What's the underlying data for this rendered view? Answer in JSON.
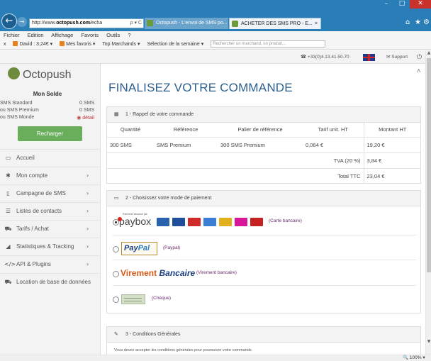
{
  "browser": {
    "address_prefix": "http://www.",
    "address_domain": "octopush.com",
    "address_suffix": "/echa",
    "address_controls": "ρ ▾ C",
    "tabs": [
      {
        "label": "Octopush - L'envoi de SMS po..."
      },
      {
        "label": "ACHETER DES SMS PRO - E...",
        "close": "×"
      }
    ],
    "window_controls": {
      "minimize": "–",
      "maximize": "□",
      "close": "✕"
    },
    "menu": [
      "Fichier",
      "Edition",
      "Affichage",
      "Favoris",
      "Outils",
      "?"
    ],
    "favorites": {
      "close": "x",
      "account": "David : 3,24€ ▾",
      "items": [
        "Mes favoris ▾",
        "Top Marchands ▾",
        "Sélection de la semaine ▾"
      ],
      "search_placeholder": "Rechercher un marchand, un produit..."
    },
    "zoom": "🔍 100%  ▾"
  },
  "topbar": {
    "phone": "☎ +33(0)4.13.41.50.70",
    "support": "✉ Support",
    "power": "⏻ ∧"
  },
  "sidebar": {
    "logo_text": "Octopush",
    "solde_title": "Mon Solde",
    "balances": [
      {
        "label": "SMS Standard",
        "value": "0 SMS"
      },
      {
        "label": "ou SMS Premium",
        "value": "0 SMS"
      },
      {
        "label": "ou SMS Monde",
        "value": "◉ détail"
      }
    ],
    "recharge_label": "Recharger",
    "nav": [
      {
        "icon": "▭",
        "label": "Accueil",
        "chevron": ""
      },
      {
        "icon": "✱",
        "label": "Mon compte",
        "chevron": "›"
      },
      {
        "icon": "▯",
        "label": "Campagne de SMS",
        "chevron": "›"
      },
      {
        "icon": "☰",
        "label": "Listes de contacts",
        "chevron": "›"
      },
      {
        "icon": "⛟",
        "label": "Tarifs / Achat",
        "chevron": "›"
      },
      {
        "icon": "◢",
        "label": "Statistiques & Tracking",
        "chevron": "›"
      },
      {
        "icon": "</>",
        "label": "API & Plugins",
        "chevron": "›"
      },
      {
        "icon": "⛟",
        "label": "Location de base de données",
        "chevron": ""
      }
    ]
  },
  "main": {
    "title": "FINALISEZ VOTRE COMMANDE",
    "section1": {
      "icon": "▦",
      "title": "1 - Rappel de votre commande",
      "headers": [
        "Quantité",
        "Référence",
        "Palier de référence",
        "Tarif unit. HT",
        "Montant HT"
      ],
      "row": [
        "300 SMS",
        "SMS Premium",
        "300 SMS Premium",
        "0,064 €",
        "19,20 €"
      ],
      "tva_label": "TVA (20 %)",
      "tva_value": "3,84 €",
      "total_label": "Total TTC",
      "total_value": "23,04 €"
    },
    "section2": {
      "icon": "▭",
      "title": "2 - Choisissez votre mode de paiement",
      "options": [
        {
          "logo": "paybox",
          "sub": "Paiement sécurisé par",
          "label": "(Carte bancaire)",
          "selected": true
        },
        {
          "logo_a": "Pay",
          "logo_b": "Pal",
          "label": "(Paypal)",
          "selected": false
        },
        {
          "logo_a": "Virement",
          "logo_b": "Bancaire",
          "label": "(Virement bancaire)",
          "selected": false
        },
        {
          "label": "(Chèque)",
          "selected": false
        }
      ],
      "card_colors": [
        "#2a62b0",
        "#1f4e9a",
        "#d02a2a",
        "#3b7ed6",
        "#e2b01a",
        "#d8169a",
        "#c62020"
      ]
    },
    "section3": {
      "icon": "✎",
      "title": "3 - Conditions Générales",
      "note": "Vous devez accepter les conditions générales pour poursuivre votre commande."
    }
  }
}
